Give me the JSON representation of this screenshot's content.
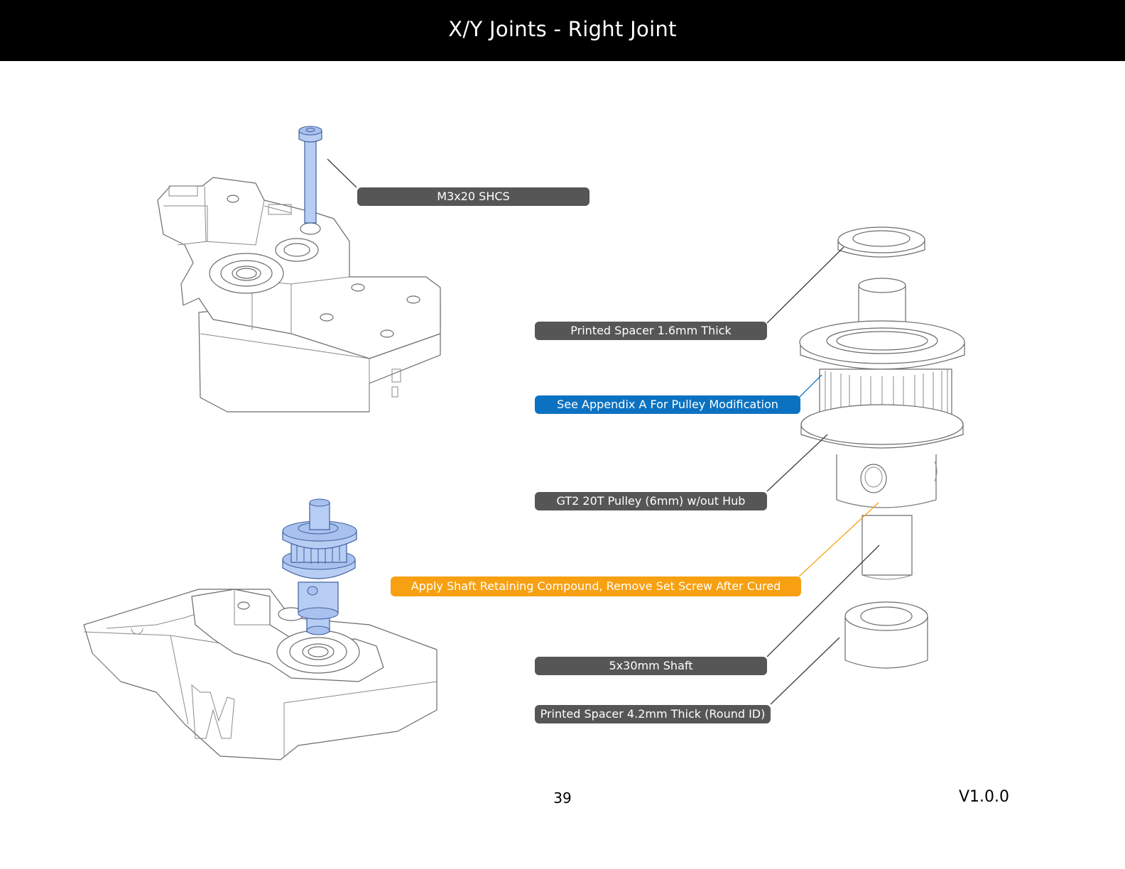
{
  "header": {
    "title": "X/Y Joints - Right Joint"
  },
  "callouts": {
    "m3x20": "M3x20 SHCS",
    "spacer16": "Printed Spacer 1.6mm Thick",
    "appendix": "See Appendix A For Pulley Modification",
    "pulley": "GT2 20T Pulley (6mm) w/out Hub",
    "compound": "Apply Shaft Retaining Compound, Remove Set Screw After Cured",
    "shaft": "5x30mm Shaft",
    "spacer42": "Printed Spacer 4.2mm Thick (Round ID)"
  },
  "footer": {
    "page_number": "39",
    "version": "V1.0.0"
  },
  "colors": {
    "header_bg": "#000000",
    "callout_gray": "#565656",
    "callout_blue": "#0b72c1",
    "callout_orange": "#f7a012",
    "highlight_part": "#b7cdf3"
  }
}
